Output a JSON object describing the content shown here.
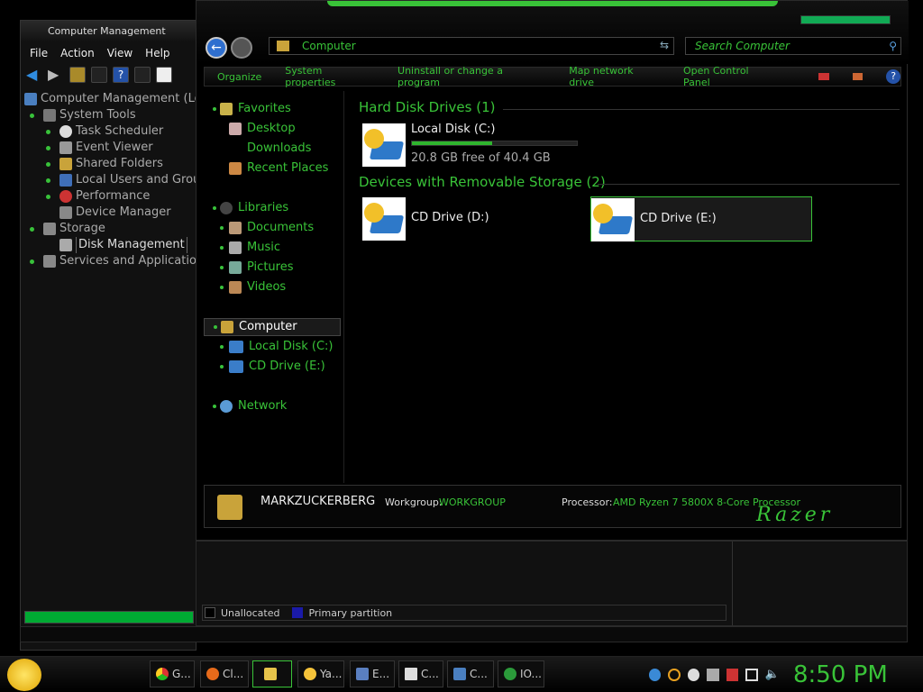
{
  "cm": {
    "title": "Computer Management",
    "menu": [
      "File",
      "Action",
      "View",
      "Help"
    ],
    "tree": [
      "Computer Management (Loc",
      "System Tools",
      "Task Scheduler",
      "Event Viewer",
      "Shared Folders",
      "Local Users and Grou",
      "Performance",
      "Device Manager",
      "Storage",
      "Disk Management",
      "Services and Applications"
    ]
  },
  "explorer": {
    "address": "Computer",
    "search_placeholder": "Search Computer",
    "commands": [
      "Organize",
      "System properties",
      "Uninstall or change a program",
      "Map network drive",
      "Open Control Panel"
    ],
    "nav": {
      "favorites": "Favorites",
      "desktop": "Desktop",
      "downloads": "Downloads",
      "recent": "Recent Places",
      "libraries": "Libraries",
      "documents": "Documents",
      "music": "Music",
      "pictures": "Pictures",
      "videos": "Videos",
      "computer": "Computer",
      "local_disk": "Local Disk (C:)",
      "cd_drive": "CD Drive (E:)",
      "network": "Network"
    },
    "hdd_header": "Hard Disk Drives (1)",
    "local_disk": {
      "name": "Local Disk (C:)",
      "free": "20.8 GB free of 40.4 GB",
      "used_fraction": 0.485
    },
    "removable_header": "Devices with Removable Storage (2)",
    "cd_d": "CD Drive (D:)",
    "cd_e": "CD Drive (E:)",
    "details": {
      "computer_name": "MARKZUCKERBERG",
      "workgroup_label": "Workgroup:",
      "workgroup": "WORKGROUP",
      "processor_label": "Processor:",
      "processor": "AMD Ryzen 7 5800X 8-Core Processor",
      "brand": "Razer"
    }
  },
  "diskmgmt": {
    "legend": [
      "Unallocated",
      "Primary partition"
    ]
  },
  "taskbar": {
    "items": [
      "G...",
      "Cl...",
      "",
      "Ya...",
      "E...",
      "C...",
      "C...",
      "IO..."
    ],
    "clock": "8:50 PM"
  },
  "colors": {
    "accent": "#39c338",
    "bg": "#000000"
  }
}
